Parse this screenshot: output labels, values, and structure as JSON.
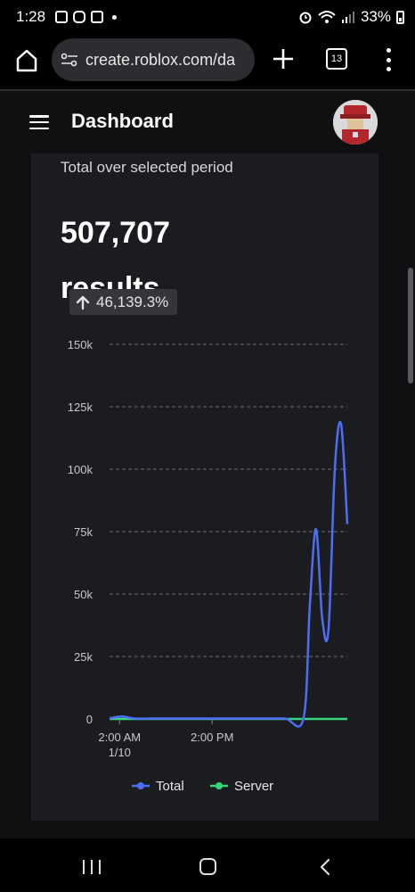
{
  "status_bar": {
    "time": "1:28",
    "battery": "33%"
  },
  "browser": {
    "url": "create.roblox.com/da",
    "tab_count": "13"
  },
  "header": {
    "title": "Dashboard"
  },
  "summary": {
    "label": "Total over selected period",
    "value": "507,707",
    "unit": "results",
    "change": "46,139.3%",
    "change_direction": "up"
  },
  "chart_data": {
    "type": "line",
    "x_tick_labels": [
      [
        "2:00 AM",
        "1/10"
      ],
      [
        "2:00 PM"
      ]
    ],
    "y_tick_labels": [
      "0",
      "25k",
      "50k",
      "75k",
      "100k",
      "125k",
      "150k"
    ],
    "ylim": [
      0,
      150000
    ],
    "grid": true,
    "legend_placement": "bottom",
    "series": [
      {
        "name": "Total",
        "color": "#4c6ef5",
        "x_hours": [
          0,
          1,
          2,
          4,
          6,
          8,
          10,
          12,
          14,
          15.5,
          16,
          16.5,
          17,
          17.5,
          18,
          18.5,
          19
        ],
        "values": [
          300,
          1000,
          200,
          200,
          200,
          200,
          200,
          200,
          200,
          300,
          45000,
          76000,
          40000,
          36000,
          100000,
          118000,
          78000
        ]
      },
      {
        "name": "Server",
        "color": "#37d67a",
        "x_hours": [
          0,
          19
        ],
        "values": [
          0,
          0
        ]
      }
    ]
  }
}
